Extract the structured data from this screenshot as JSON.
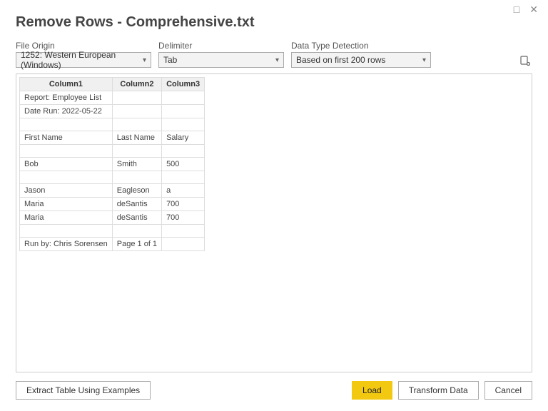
{
  "window": {
    "title": "Remove Rows - Comprehensive.txt"
  },
  "options": {
    "file_origin": {
      "label": "File Origin",
      "value": "1252: Western European (Windows)"
    },
    "delimiter": {
      "label": "Delimiter",
      "value": "Tab"
    },
    "detection": {
      "label": "Data Type Detection",
      "value": "Based on first 200 rows"
    }
  },
  "table": {
    "columns": [
      "Column1",
      "Column2",
      "Column3"
    ],
    "rows": [
      [
        "Report: Employee List",
        "",
        ""
      ],
      [
        "Date Run: 2022-05-22",
        "",
        ""
      ],
      [
        "",
        "",
        ""
      ],
      [
        "First Name",
        "Last Name",
        "Salary"
      ],
      [
        "",
        "",
        ""
      ],
      [
        "Bob",
        "Smith",
        "500"
      ],
      [
        "",
        "",
        ""
      ],
      [
        "Jason",
        "Eagleson",
        "a"
      ],
      [
        "Maria",
        "deSantis",
        "700"
      ],
      [
        "Maria",
        "deSantis",
        "700"
      ],
      [
        "",
        "",
        ""
      ],
      [
        "Run by: Chris Sorensen",
        "Page 1 of 1",
        ""
      ]
    ]
  },
  "buttons": {
    "extract": "Extract Table Using Examples",
    "load": "Load",
    "transform": "Transform Data",
    "cancel": "Cancel"
  }
}
